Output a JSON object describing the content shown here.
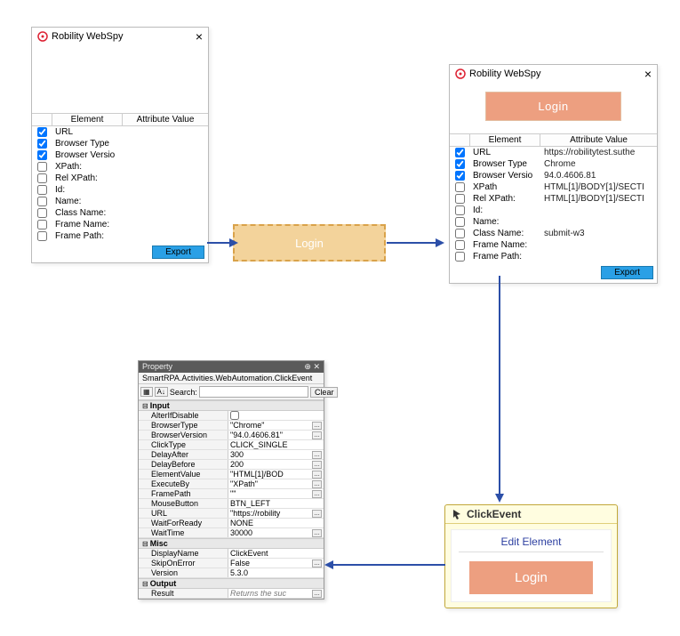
{
  "app_title": "Robility WebSpy",
  "close_glyph": "×",
  "table_header": {
    "element": "Element",
    "value": "Attribute Value"
  },
  "rows1": [
    {
      "checked": true,
      "name": "URL",
      "value": ""
    },
    {
      "checked": true,
      "name": "Browser Type",
      "value": ""
    },
    {
      "checked": true,
      "name": "Browser Versio",
      "value": ""
    },
    {
      "checked": false,
      "name": "XPath:",
      "value": ""
    },
    {
      "checked": false,
      "name": "Rel XPath:",
      "value": ""
    },
    {
      "checked": false,
      "name": "Id:",
      "value": ""
    },
    {
      "checked": false,
      "name": "Name:",
      "value": ""
    },
    {
      "checked": false,
      "name": "Class Name:",
      "value": ""
    },
    {
      "checked": false,
      "name": "Frame Name:",
      "value": ""
    },
    {
      "checked": false,
      "name": "Frame Path:",
      "value": ""
    }
  ],
  "rows2": [
    {
      "checked": true,
      "name": "URL",
      "value": "https://robilitytest.suthe"
    },
    {
      "checked": true,
      "name": "Browser Type",
      "value": "Chrome"
    },
    {
      "checked": true,
      "name": "Browser Versio",
      "value": "94.0.4606.81"
    },
    {
      "checked": false,
      "name": "XPath",
      "value": "HTML[1]/BODY[1]/SECTI"
    },
    {
      "checked": false,
      "name": "Rel XPath:",
      "value": "HTML[1]/BODY[1]/SECTI"
    },
    {
      "checked": false,
      "name": "Id:",
      "value": ""
    },
    {
      "checked": false,
      "name": "Name:",
      "value": ""
    },
    {
      "checked": false,
      "name": "Class Name:",
      "value": "submit-w3"
    },
    {
      "checked": false,
      "name": "Frame Name:",
      "value": ""
    },
    {
      "checked": false,
      "name": "Frame Path:",
      "value": ""
    }
  ],
  "export_label": "Export",
  "login_label": "Login",
  "click_card": {
    "title": "ClickEvent",
    "edit": "Edit Element",
    "button": "Login"
  },
  "prop": {
    "title": "Property",
    "pin": "⊕ ✕",
    "class": "SmartRPA.Activities.WebAutomation.ClickEvent",
    "search_label": "Search:",
    "clear": "Clear",
    "groups": {
      "input": "Input",
      "misc": "Misc",
      "output": "Output"
    },
    "input_rows": [
      {
        "name": "AlterIfDisable",
        "value": "",
        "checkbox": true
      },
      {
        "name": "BrowserType",
        "value": "\"Chrome\"",
        "ell": true
      },
      {
        "name": "BrowserVersion",
        "value": "\"94.0.4606.81\"",
        "ell": true
      },
      {
        "name": "ClickType",
        "value": "CLICK_SINGLE"
      },
      {
        "name": "DelayAfter",
        "value": "300",
        "ell": true
      },
      {
        "name": "DelayBefore",
        "value": "200",
        "ell": true
      },
      {
        "name": "ElementValue",
        "value": "\"HTML[1]/BOD",
        "ell": true
      },
      {
        "name": "ExecuteBy",
        "value": "\"XPath\"",
        "ell": true
      },
      {
        "name": "FramePath",
        "value": "\"\"",
        "ell": true
      },
      {
        "name": "MouseButton",
        "value": "BTN_LEFT"
      },
      {
        "name": "URL",
        "value": "\"https://robility",
        "ell": true
      },
      {
        "name": "WaitForReady",
        "value": "NONE"
      },
      {
        "name": "WaitTime",
        "value": "30000",
        "ell": true
      }
    ],
    "misc_rows": [
      {
        "name": "DisplayName",
        "value": "ClickEvent"
      },
      {
        "name": "SkipOnError",
        "value": "False",
        "ell": true
      },
      {
        "name": "Version",
        "value": "5.3.0"
      }
    ],
    "output_rows": [
      {
        "name": "Result",
        "value": "Returns the suc",
        "ell": true,
        "italic": true
      }
    ]
  }
}
